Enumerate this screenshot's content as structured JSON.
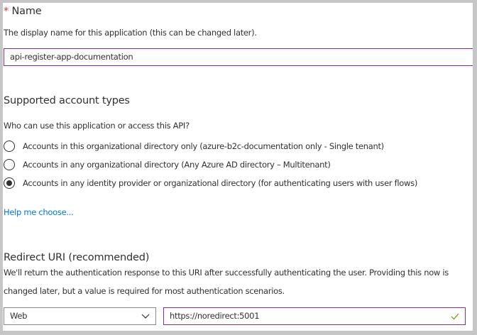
{
  "name_section": {
    "required_marker": "*",
    "label": "Name",
    "description": "The display name for this application (this can be changed later).",
    "value": "api-register-app-documentation"
  },
  "account_types": {
    "heading": "Supported account types",
    "question": "Who can use this application or access this API?",
    "options": [
      {
        "label": "Accounts in this organizational directory only (azure-b2c-documentation only - Single tenant)",
        "selected": false
      },
      {
        "label": "Accounts in any organizational directory (Any Azure AD directory – Multitenant)",
        "selected": false
      },
      {
        "label": "Accounts in any identity provider or organizational directory (for authenticating users with user flows)",
        "selected": true
      }
    ],
    "help_link": "Help me choose..."
  },
  "redirect": {
    "heading": "Redirect URI (recommended)",
    "description_line1": "We'll return the authentication response to this URI after successfully authenticating the user. Providing this now is",
    "description_line2": "changed later, but a value is required for most authentication scenarios.",
    "platform": "Web",
    "uri": "https://noredirect:5001"
  },
  "colors": {
    "focus_border": "#8a2da5",
    "link": "#0078d4",
    "required": "#d13438",
    "valid_check": "#57a300"
  }
}
